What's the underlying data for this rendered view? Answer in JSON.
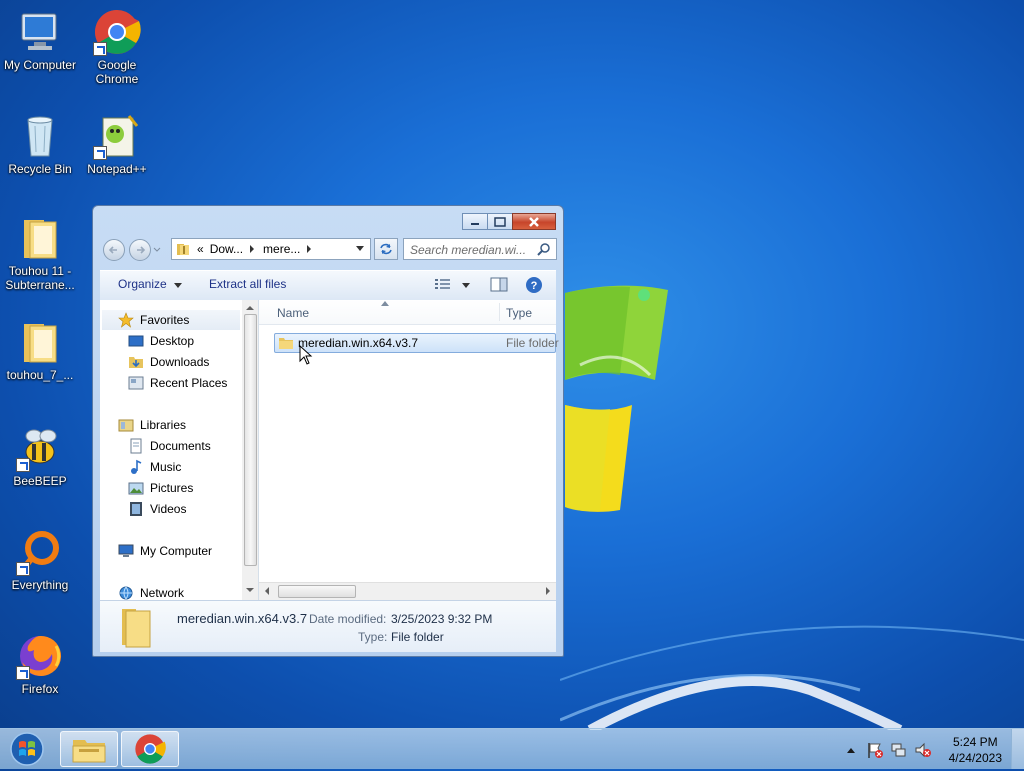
{
  "desktop": {
    "icons": [
      {
        "label": "My Computer",
        "icon": "computer-icon"
      },
      {
        "label": "Google Chrome",
        "icon": "chrome-icon"
      },
      {
        "label": "Recycle Bin",
        "icon": "recycle-bin-icon"
      },
      {
        "label": "Notepad++",
        "icon": "notepadpp-icon"
      },
      {
        "label": "Touhou 11 - Subterrane...",
        "icon": "folder-icon"
      },
      {
        "label": "touhou_7_...",
        "icon": "folder-icon"
      },
      {
        "label": "BeeBEEP",
        "icon": "bee-icon"
      },
      {
        "label": "Everything",
        "icon": "everything-icon"
      },
      {
        "label": "Firefox",
        "icon": "firefox-icon"
      }
    ]
  },
  "explorer": {
    "address": {
      "prefix": "«",
      "segments": [
        "Dow...",
        "mere..."
      ]
    },
    "search_placeholder": "Search meredian.wi...",
    "toolbar": {
      "organize": "Organize",
      "extract_all": "Extract all files"
    },
    "nav_pane": {
      "favorites": {
        "label": "Favorites",
        "items": [
          "Desktop",
          "Downloads",
          "Recent Places"
        ]
      },
      "libraries": {
        "label": "Libraries",
        "items": [
          "Documents",
          "Music",
          "Pictures",
          "Videos"
        ]
      },
      "computer": "My Computer",
      "network": "Network"
    },
    "columns": {
      "name": "Name",
      "type": "Type"
    },
    "files": [
      {
        "name": "meredian.win.x64.v3.7",
        "type": "File folder"
      }
    ],
    "details": {
      "name": "meredian.win.x64.v3.7",
      "date_label": "Date modified:",
      "date_value": "3/25/2023 9:32 PM",
      "type_label": "Type:",
      "type_value": "File folder"
    }
  },
  "taskbar": {
    "time": "5:24 PM",
    "date": "4/24/2023"
  },
  "colors": {
    "accent": "#1e3287",
    "selection": "#cde2f9",
    "close": "#c7452b"
  }
}
